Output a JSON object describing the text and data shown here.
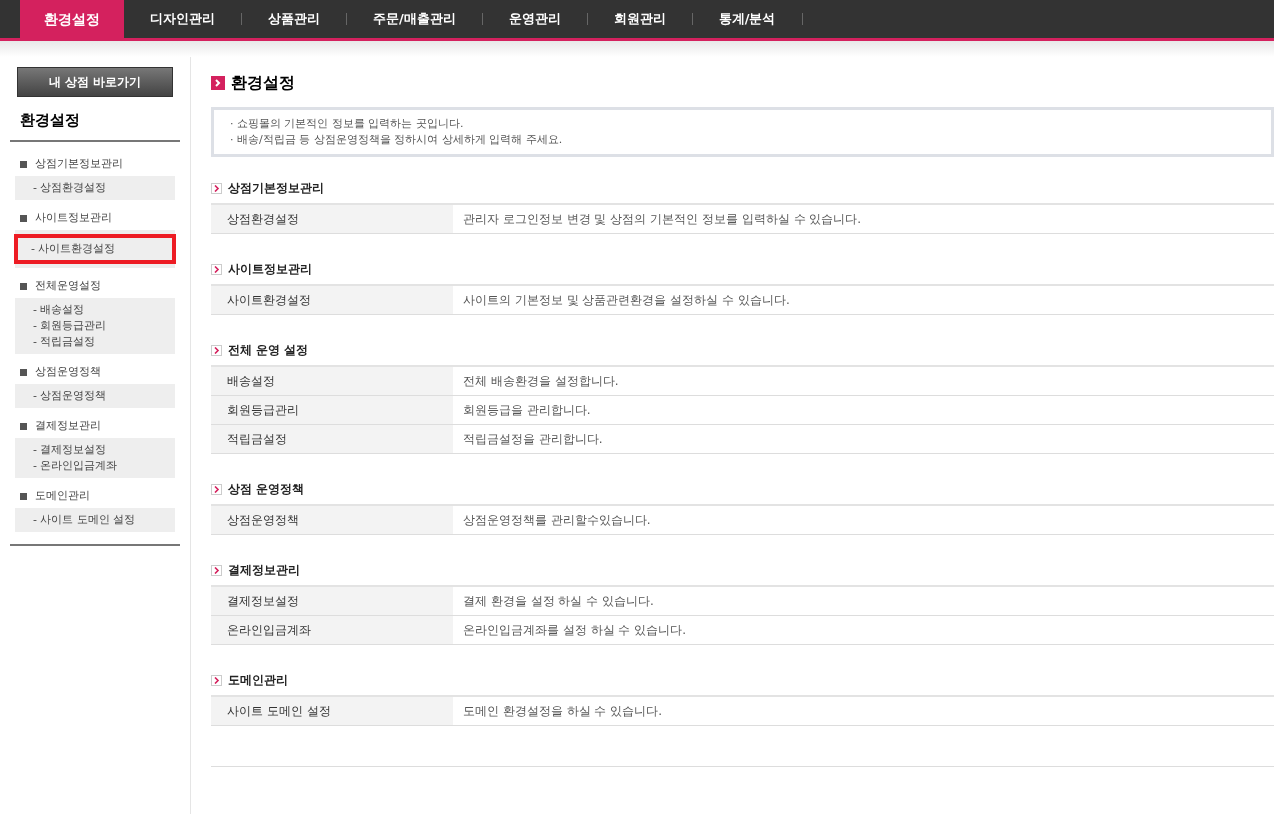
{
  "nav": [
    {
      "label": "환경설정",
      "selected": true
    },
    {
      "label": "디자인관리",
      "selected": false
    },
    {
      "label": "상품관리",
      "selected": false
    },
    {
      "label": "주문/매출관리",
      "selected": false
    },
    {
      "label": "운영관리",
      "selected": false
    },
    {
      "label": "회원관리",
      "selected": false
    },
    {
      "label": "통계/분석",
      "selected": false
    }
  ],
  "sidebar": {
    "shop_button": "내 상점 바로가기",
    "title": "환경설정",
    "groups": [
      {
        "label": "상점기본정보관리",
        "items": [
          {
            "label": "- 상점환경설정",
            "selected": false
          }
        ]
      },
      {
        "label": "사이트정보관리",
        "items": [
          {
            "label": "- 사이트환경설정",
            "selected": true
          }
        ]
      },
      {
        "label": "전체운영설정",
        "items": [
          {
            "label": "- 배송설정",
            "selected": false
          },
          {
            "label": "- 회원등급관리",
            "selected": false
          },
          {
            "label": "- 적립금설정",
            "selected": false
          }
        ]
      },
      {
        "label": "상점운영정책",
        "items": [
          {
            "label": "- 상점운영정책",
            "selected": false
          }
        ]
      },
      {
        "label": "결제정보관리",
        "items": [
          {
            "label": "- 결제정보설정",
            "selected": false
          },
          {
            "label": "- 온라인입금계좌",
            "selected": false
          }
        ]
      },
      {
        "label": "도메인관리",
        "items": [
          {
            "label": "- 사이트 도메인 설정",
            "selected": false
          }
        ]
      }
    ]
  },
  "page_title": "환경설정",
  "notes": [
    "· 쇼핑몰의 기본적인 정보를 입력하는 곳입니다.",
    "· 배송/적립금 등 상점운영정책을 정하시여 상세하게 입력해 주세요."
  ],
  "sections": [
    {
      "title": "상점기본정보관리",
      "rows": [
        {
          "name": "상점환경설정",
          "description": "관리자 로그인정보 변경 및 상점의 기본적인 정보를 입력하실 수 있습니다."
        }
      ]
    },
    {
      "title": "사이트정보관리",
      "rows": [
        {
          "name": "사이트환경설정",
          "description": "사이트의 기본정보 및 상품관련환경을 설정하실 수 있습니다."
        }
      ]
    },
    {
      "title": "전체 운영 설정",
      "rows": [
        {
          "name": "배송설정",
          "description": "전체 배송환경을 설정합니다."
        },
        {
          "name": "회원등급관리",
          "description": "회원등급을 관리합니다."
        },
        {
          "name": "적립금설정",
          "description": "적립금설정을 관리합니다."
        }
      ]
    },
    {
      "title": "상점 운영정책",
      "rows": [
        {
          "name": "상점운영정책",
          "description": "상점운영정책를 관리할수있습니다."
        }
      ]
    },
    {
      "title": "결제정보관리",
      "rows": [
        {
          "name": "결제정보설정",
          "description": "결제 환경을 설정 하실 수 있습니다."
        },
        {
          "name": "온라인입금계좌",
          "description": "온라인입금계좌를 설정 하실 수 있습니다."
        }
      ]
    },
    {
      "title": "도메인관리",
      "rows": [
        {
          "name": "사이트 도메인 설정",
          "description": "도메인 환경설정을 하실 수 있습니다."
        }
      ]
    }
  ]
}
